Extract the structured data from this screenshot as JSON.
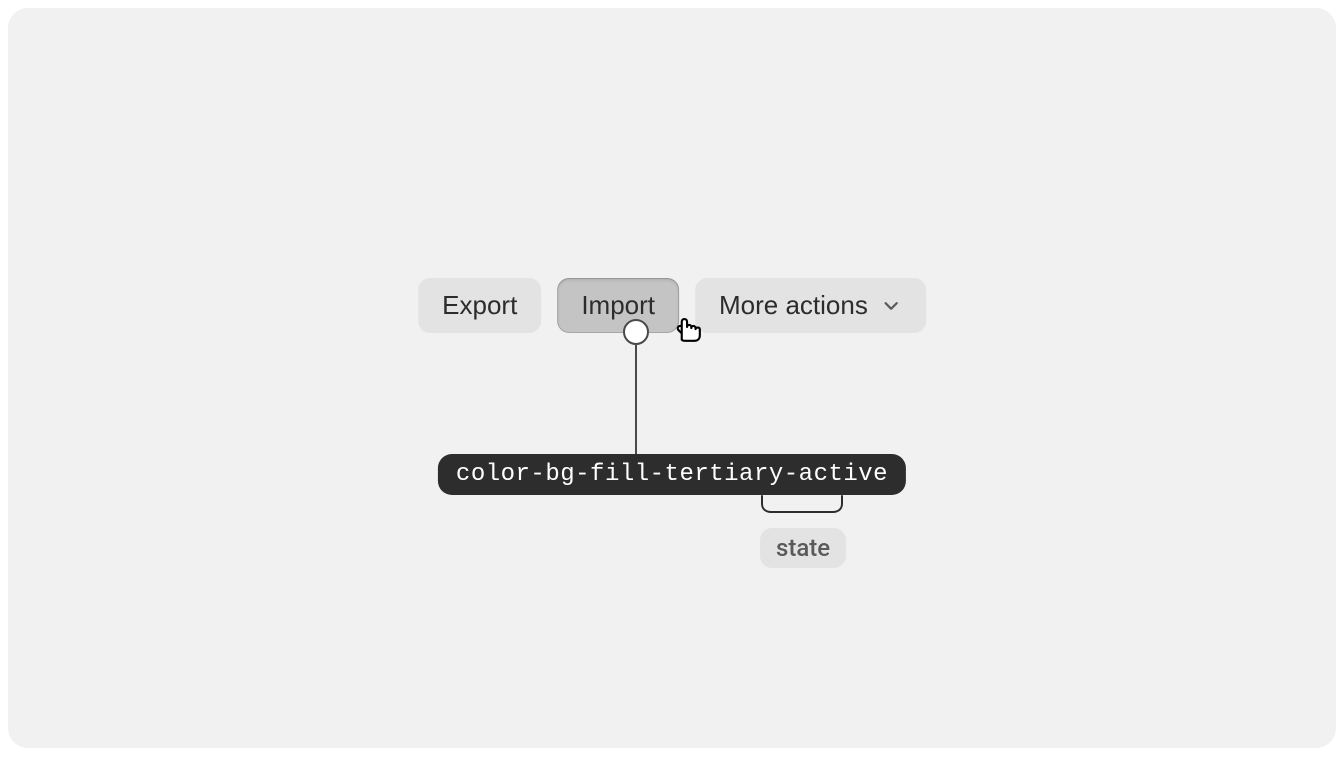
{
  "buttons": {
    "export": "Export",
    "import": "Import",
    "more_actions": "More actions"
  },
  "token": "color-bg-fill-tertiary-active",
  "annotation_label": "state",
  "colors": {
    "canvas_bg": "#f1f1f1",
    "btn_bg": "#e3e3e3",
    "btn_active_bg": "#c4c4c4",
    "token_bg": "#2d2d2d"
  }
}
